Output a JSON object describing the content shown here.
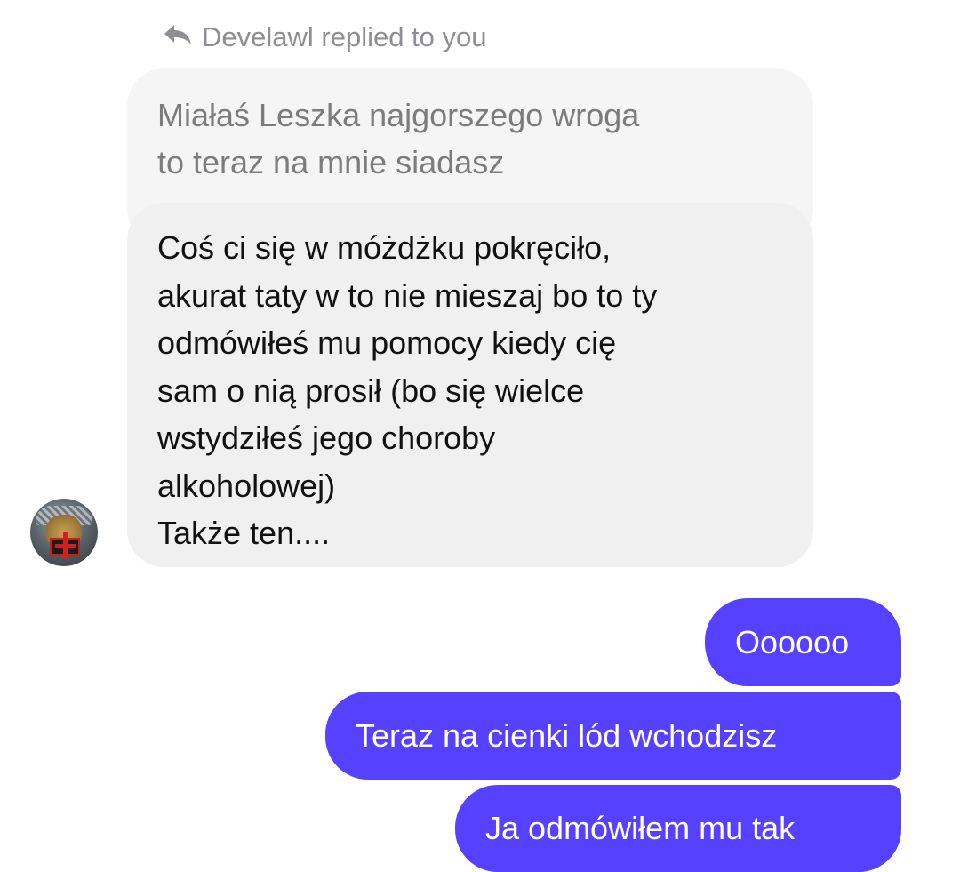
{
  "reply_header": {
    "icon": "reply-arrow-icon",
    "text": "Develawl replied to you"
  },
  "quoted_message": {
    "text": "Miałaś Leszka najgorszego wroga\nto teraz na mnie siadasz"
  },
  "incoming_message": {
    "text": "Coś ci się w móżdżku pokręciło,\nakurat taty w to nie mieszaj bo to ty\nodmówiłeś mu pomocy kiedy cię\nsam o nią prosił (bo się wielce\nwstydziłeś jego choroby\nalkoholowej)\nTakże ten...."
  },
  "avatar": {
    "icon": "user-avatar"
  },
  "outgoing_messages": [
    {
      "text": "Oooooo"
    },
    {
      "text": "Teraz na cienki lód wchodzisz"
    },
    {
      "text": "Ja odmówiłem mu tak"
    }
  ],
  "colors": {
    "outgoing_bubble": "#5541ff",
    "incoming_bubble": "#f0f0f0",
    "quoted_bubble": "#f5f5f5",
    "meta_text": "#8e8e93"
  }
}
